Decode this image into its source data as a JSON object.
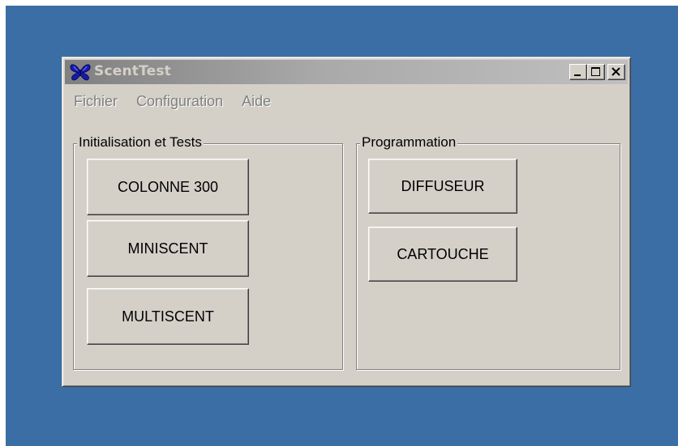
{
  "window": {
    "title": "ScentTest",
    "controls": {
      "minimize": "minimize-icon",
      "maximize": "maximize-icon",
      "close": "close-icon"
    }
  },
  "menubar": {
    "items": [
      "Fichier",
      "Configuration",
      "Aide"
    ]
  },
  "groups": {
    "init": {
      "legend": "Initialisation et Tests",
      "buttons": [
        "COLONNE 300",
        "MINISCENT",
        "MULTISCENT"
      ]
    },
    "prog": {
      "legend": "Programmation",
      "buttons": [
        "DIFFUSEUR",
        "CARTOUCHE"
      ]
    }
  },
  "colors": {
    "desktop": "#3a6ea5",
    "window_face": "#d4d0c8",
    "titlebar_inactive_start": "#808080",
    "titlebar_inactive_end": "#c0c0c0",
    "menu_text_disabled": "#808080",
    "app_icon": "#1a1aa8"
  }
}
